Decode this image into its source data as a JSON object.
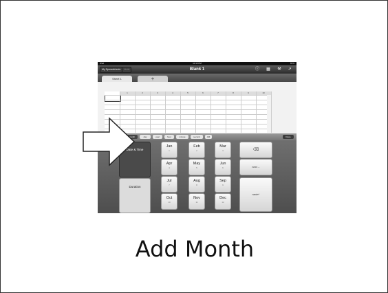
{
  "ipad": {
    "status": {
      "carrier": "iPad",
      "time": "10:13 PM",
      "battery": "81%"
    },
    "navbar": {
      "spreadsheets_label": "My Spreadsheets",
      "undo_label": "Undo",
      "title": "Blank 1"
    },
    "tabs": {
      "sheet_label": "Sheet 1",
      "add_label": "+"
    },
    "grid": {
      "columns": [
        "1",
        "2",
        "3",
        "4",
        "5",
        "6",
        "7",
        "8",
        "9",
        "10"
      ]
    },
    "units": {
      "chips": [
        "month",
        "day",
        "year",
        "hour",
        "minute",
        "second",
        "AM"
      ],
      "done_label": "Done"
    },
    "keyboard": {
      "date_time_label": "Date & Time",
      "duration_label": "Duration",
      "months": [
        {
          "name": "Jan",
          "num": "1"
        },
        {
          "name": "Feb",
          "num": "2"
        },
        {
          "name": "Mar",
          "num": "3"
        },
        {
          "name": "Apr",
          "num": "4"
        },
        {
          "name": "May",
          "num": "5"
        },
        {
          "name": "Jun",
          "num": "6"
        },
        {
          "name": "Jul",
          "num": "7"
        },
        {
          "name": "Aug",
          "num": "8"
        },
        {
          "name": "Sep",
          "num": "9"
        },
        {
          "name": "Oct",
          "num": "10"
        },
        {
          "name": "Nov",
          "num": "11"
        },
        {
          "name": "Dec",
          "num": "12"
        }
      ],
      "delete_glyph": "⌫",
      "next_label": "next→",
      "enter_label": "next↵"
    }
  },
  "caption": "Add Month"
}
